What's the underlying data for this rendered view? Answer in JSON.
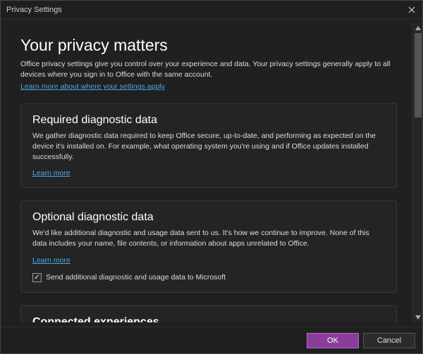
{
  "window": {
    "title": "Privacy Settings"
  },
  "intro": {
    "heading": "Your privacy matters",
    "description": "Office privacy settings give you control over your experience and data. Your privacy settings generally apply to all devices where you sign in to Office with the same account.",
    "link": "Learn more about where your settings apply"
  },
  "required": {
    "title": "Required diagnostic data",
    "description": "We gather diagnostic data required to keep Office secure, up-to-date, and performing as expected on the device it's installed on. For example, what operating system you're using and if Office updates installed successfully.",
    "link": "Learn more"
  },
  "optional": {
    "title": "Optional diagnostic data",
    "description": "We'd like additional diagnostic and usage data sent to us. It's how we continue to improve. None of this data includes your name, file contents, or information about apps unrelated to Office.",
    "link": "Learn more",
    "checkbox_checked": "✓",
    "checkbox_label": "Send additional diagnostic and usage data to Microsoft"
  },
  "connected": {
    "title": "Connected experiences"
  },
  "footer": {
    "ok": "OK",
    "cancel": "Cancel"
  }
}
